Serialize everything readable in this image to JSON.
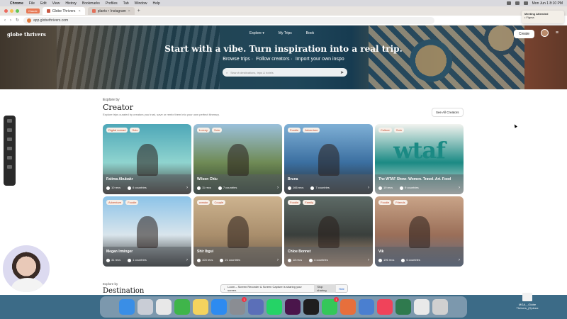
{
  "menubar": {
    "app": "Chrome",
    "items": [
      "File",
      "Edit",
      "View",
      "History",
      "Bookmarks",
      "Profiles",
      "Tab",
      "Window",
      "Help"
    ],
    "clock": "Mon Jun 1 8:10 PM"
  },
  "tabs": [
    {
      "label": "Globe Thrivers",
      "active": true
    },
    {
      "label": "plants • Instagram",
      "active": false
    }
  ],
  "tab_badge": "Claude",
  "address": {
    "url": "app.globethrivers.com"
  },
  "notification": {
    "title": "Meeting Attended",
    "body": "• Figma"
  },
  "header": {
    "logo": "globe thrivers",
    "nav": [
      "Explore ▾",
      "My Trips",
      "Book"
    ],
    "create_label": "Create"
  },
  "hero": {
    "title": "Start with a vibe. Turn inspiration into a real trip.",
    "links": [
      "Browse trips",
      "Follow creators",
      "Import your own inspo"
    ],
    "search_placeholder": "Search destinations, trips & hotels"
  },
  "creator_section": {
    "label": "Explore by",
    "title": "Creator",
    "description": "Explore trips curated by creators you trust, save or remix them into your own perfect itinerary.",
    "see_all": "See All Creators"
  },
  "creators": [
    {
      "name": "Fatima Abubakr",
      "tags": [
        "Digital nomad",
        "Solo"
      ],
      "recs": "10 recs",
      "countries": "6 countries",
      "colors": [
        "#4ea7b8",
        "#8fd4cf",
        "#3b2e28"
      ]
    },
    {
      "name": "Wilson Chiu",
      "tags": [
        "Luxury",
        "Solo"
      ],
      "recs": "11 recs",
      "countries": "7 countries",
      "colors": [
        "#9bc1db",
        "#6f8a55",
        "#2a3a2c"
      ]
    },
    {
      "name": "Bruna",
      "tags": [
        "Foodie",
        "Adventure"
      ],
      "recs": "166 recs",
      "countries": "7 countries",
      "colors": [
        "#7fb0d6",
        "#3b6fa0",
        "#2a2a2a"
      ]
    },
    {
      "name": "The WTAF Show- Women. Travel. Art. Food",
      "tags": [
        "Culture",
        "Solo"
      ],
      "recs": "19 recs",
      "countries": "9 countries",
      "colors": [
        "#f2f3ef",
        "#1b8a84",
        "#e9ebe6"
      ]
    },
    {
      "name": "Megan Irminger",
      "tags": [
        "Adventure",
        "Foodie"
      ],
      "recs": "31 recs",
      "countries": "1 countries",
      "colors": [
        "#8cc3e8",
        "#d9e5ec",
        "#2b2b2b"
      ]
    },
    {
      "name": "Shir Ibgui",
      "tags": [
        "creator",
        "Couple"
      ],
      "recs": "103 recs",
      "countries": "21 countries",
      "colors": [
        "#cdb38f",
        "#a98e6c",
        "#6b5a48"
      ]
    },
    {
      "name": "Chloe Bonnet",
      "tags": [
        "Foodie",
        "Family"
      ],
      "recs": "18 recs",
      "countries": "4 countries",
      "colors": [
        "#5d6a66",
        "#3a3f3c",
        "#c49a7c"
      ]
    },
    {
      "name": "Vik",
      "tags": [
        "Foodie",
        "Friends"
      ],
      "recs": "196 recs",
      "countries": "6 countries",
      "colors": [
        "#c9a488",
        "#9a6e58",
        "#5a6c88"
      ]
    }
  ],
  "destination_section": {
    "label": "Explore by",
    "title": "Destination"
  },
  "share_bar": {
    "text": "Loom – Screen Recorder & Screen Capture is sharing your screen.",
    "stop": "Stop sharing",
    "hide": "Hide"
  },
  "desktop_file": "MGA__Globe Thrivers_(3).docx",
  "dock": [
    {
      "name": "finder",
      "color": "#3a8ee6"
    },
    {
      "name": "launchpad",
      "color": "#c9cdd6"
    },
    {
      "name": "chrome",
      "color": "#e8e8e8"
    },
    {
      "name": "facetime",
      "color": "#3fb54a"
    },
    {
      "name": "notes",
      "color": "#f4d35e"
    },
    {
      "name": "app-store",
      "color": "#2d8bf0"
    },
    {
      "name": "settings",
      "color": "#8a8d93",
      "badge": "1"
    },
    {
      "name": "simulator",
      "color": "#5b6fb8"
    },
    {
      "name": "whatsapp",
      "color": "#25d366"
    },
    {
      "name": "slack",
      "color": "#4a154b"
    },
    {
      "name": "figma",
      "color": "#1e1e1e"
    },
    {
      "name": "messages",
      "color": "#34c759",
      "badge": "1"
    },
    {
      "name": "claude",
      "color": "#e76f3c"
    },
    {
      "name": "preview",
      "color": "#4a7fd0"
    },
    {
      "name": "music",
      "color": "#f0435a"
    },
    {
      "name": "loom",
      "color": "#2f7a4e"
    },
    {
      "name": "document",
      "color": "#e9e9e9"
    },
    {
      "name": "trash",
      "color": "#d0d0d0"
    }
  ]
}
